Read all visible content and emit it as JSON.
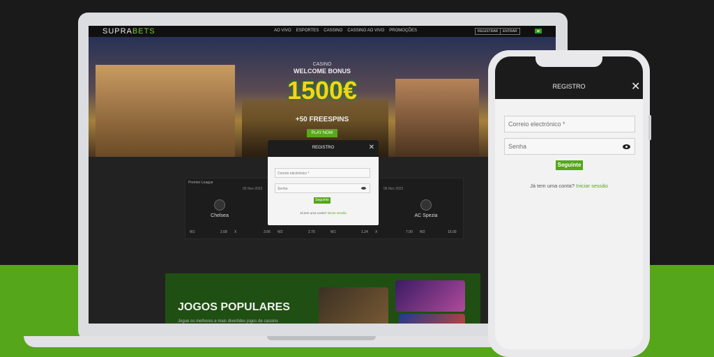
{
  "laptop": {
    "logo_main": "SUPRA",
    "logo_accent": "BETS",
    "nav": [
      "AO VIVO",
      "ESPORTES",
      "CASSINO",
      "CASSINO AO VIVO",
      "PROMOÇÕES"
    ],
    "register_label": "REGISTRAR",
    "enter_label": "ENTRAR",
    "hero": {
      "casino": "CASINO",
      "bonus_title": "WELCOME BONUS",
      "amount": "1500€",
      "freespins": "+50 FREESPINS",
      "cta": "PLAY NOW"
    },
    "sports": {
      "league": "Premier League",
      "date1": "06 Nov 2022",
      "date2": "06 Nov 2022",
      "team1": "Chelsea",
      "team2": "AC Spezia",
      "odds1": [
        "W1",
        "2.68",
        "X",
        "3.56",
        "W2",
        "2.76"
      ],
      "odds2": [
        "W1",
        "1.24",
        "X",
        "7.00",
        "W2",
        "15.00"
      ]
    },
    "games": {
      "title": "JOGOS POPULARES",
      "subtitle": "Jogue os melhores e mais divertidos jogos de cassino"
    },
    "modal": {
      "title": "REGISTRO",
      "email_placeholder": "Correio electrónico *",
      "password_placeholder": "Senha",
      "submit": "Seguinte",
      "login_prompt": "Já tem uma conta?",
      "login_link": "Iniciar sessão"
    }
  },
  "phone": {
    "title": "REGISTRO",
    "email_placeholder": "Correio electrónico *",
    "password_placeholder": "Senha",
    "submit": "Seguinte",
    "login_prompt": "Já tem uma conta?",
    "login_link": "Iniciar sessão"
  },
  "colors": {
    "brand_green": "#55a61a",
    "dark": "#1b1b1b",
    "bonus_gold": "#f7d21a"
  }
}
